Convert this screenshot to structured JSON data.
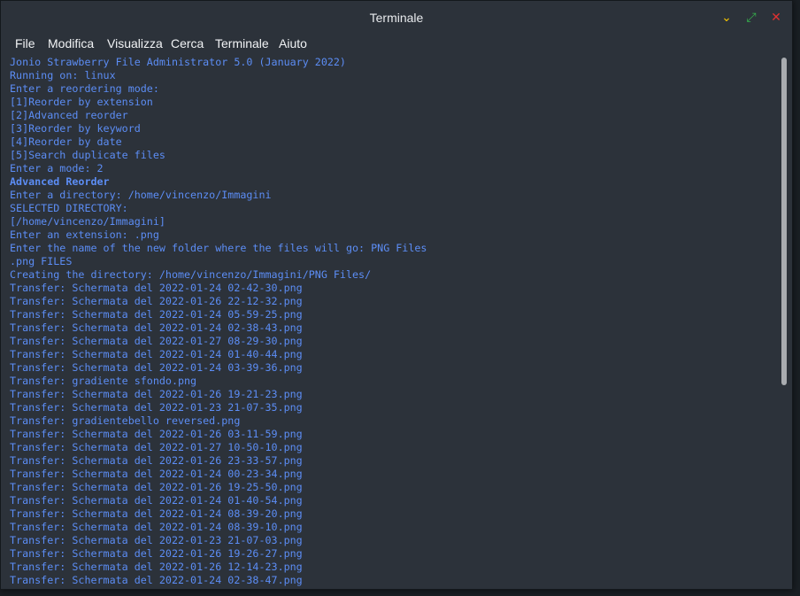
{
  "window": {
    "title": "Terminale"
  },
  "window_controls": {
    "minimize_glyph": "⌄",
    "maximize_glyph": "⤢",
    "close_glyph": "✕"
  },
  "menu": [
    "File",
    "Modifica",
    "Visualizza",
    "Cerca",
    "Terminale",
    "Aiuto"
  ],
  "colors": {
    "text": "#5c8df5",
    "background": "#2c323a",
    "minimize": "#f2c200",
    "maximize": "#37b24d",
    "close": "#e03131"
  },
  "terminal": {
    "lines": [
      "Jonio Strawberry File Administrator 5.0 (January 2022)",
      "Running on: linux",
      "Enter a reordering mode:",
      "[1]Reorder by extension",
      "[2]Advanced reorder",
      "[3]Reorder by keyword",
      "[4]Reorder by date",
      "[5]Search duplicate files",
      "Enter a mode: 2",
      "Advanced Reorder",
      "Enter a directory: /home/vincenzo/Immagini",
      "SELECTED DIRECTORY:",
      "[/home/vincenzo/Immagini]",
      "Enter an extension: .png",
      "Enter the name of the new folder where the files will go: PNG Files",
      ".png FILES",
      "Creating the directory: /home/vincenzo/Immagini/PNG Files/",
      "Transfer: Schermata del 2022-01-24 02-42-30.png",
      "Transfer: Schermata del 2022-01-26 22-12-32.png",
      "Transfer: Schermata del 2022-01-24 05-59-25.png",
      "Transfer: Schermata del 2022-01-24 02-38-43.png",
      "Transfer: Schermata del 2022-01-27 08-29-30.png",
      "Transfer: Schermata del 2022-01-24 01-40-44.png",
      "Transfer: Schermata del 2022-01-24 03-39-36.png",
      "Transfer: gradiente sfondo.png",
      "Transfer: Schermata del 2022-01-26 19-21-23.png",
      "Transfer: Schermata del 2022-01-23 21-07-35.png",
      "Transfer: gradientebello reversed.png",
      "Transfer: Schermata del 2022-01-26 03-11-59.png",
      "Transfer: Schermata del 2022-01-27 10-50-10.png",
      "Transfer: Schermata del 2022-01-26 23-33-57.png",
      "Transfer: Schermata del 2022-01-24 00-23-34.png",
      "Transfer: Schermata del 2022-01-26 19-25-50.png",
      "Transfer: Schermata del 2022-01-24 01-40-54.png",
      "Transfer: Schermata del 2022-01-24 08-39-20.png",
      "Transfer: Schermata del 2022-01-24 08-39-10.png",
      "Transfer: Schermata del 2022-01-23 21-07-03.png",
      "Transfer: Schermata del 2022-01-26 19-26-27.png",
      "Transfer: Schermata del 2022-01-26 12-14-23.png",
      "Transfer: Schermata del 2022-01-24 02-38-47.png"
    ],
    "bold_line": "Advanced Reorder"
  }
}
